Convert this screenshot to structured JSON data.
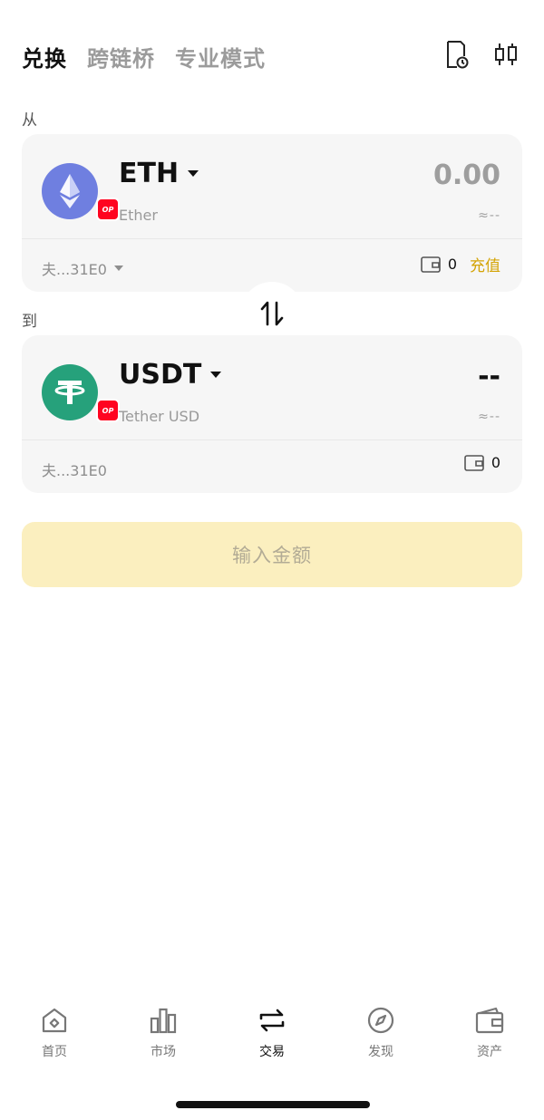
{
  "header": {
    "tabs": [
      {
        "label": "兑换",
        "active": true
      },
      {
        "label": "跨链桥",
        "active": false
      },
      {
        "label": "专业模式",
        "active": false
      }
    ],
    "icons": [
      "history-icon",
      "candlestick-icon"
    ]
  },
  "from": {
    "section_label": "从",
    "token_symbol": "ETH",
    "token_name": "Ether",
    "chain_badge": "OP",
    "amount": "0.00",
    "fiat_value": "≈--",
    "address": "夫...31E0",
    "balance": "0",
    "deposit_label": "充值"
  },
  "to": {
    "section_label": "到",
    "token_symbol": "USDT",
    "token_name": "Tether USD",
    "chain_badge": "OP",
    "amount": "--",
    "fiat_value": "≈--",
    "address": "夫...31E0",
    "balance": "0"
  },
  "cta": {
    "label": "输入金额"
  },
  "nav": {
    "items": [
      {
        "label": "首页",
        "icon": "home-icon"
      },
      {
        "label": "市场",
        "icon": "market-icon"
      },
      {
        "label": "交易",
        "icon": "trade-icon",
        "active": true
      },
      {
        "label": "发现",
        "icon": "discover-icon"
      },
      {
        "label": "资产",
        "icon": "wallet-icon"
      }
    ]
  },
  "colors": {
    "accent": "#d4a406",
    "cta_background": "#fbefbf",
    "chain_badge": "#ff0420",
    "eth_logo": "#6f7fe0",
    "usdt_logo": "#26a17b"
  }
}
